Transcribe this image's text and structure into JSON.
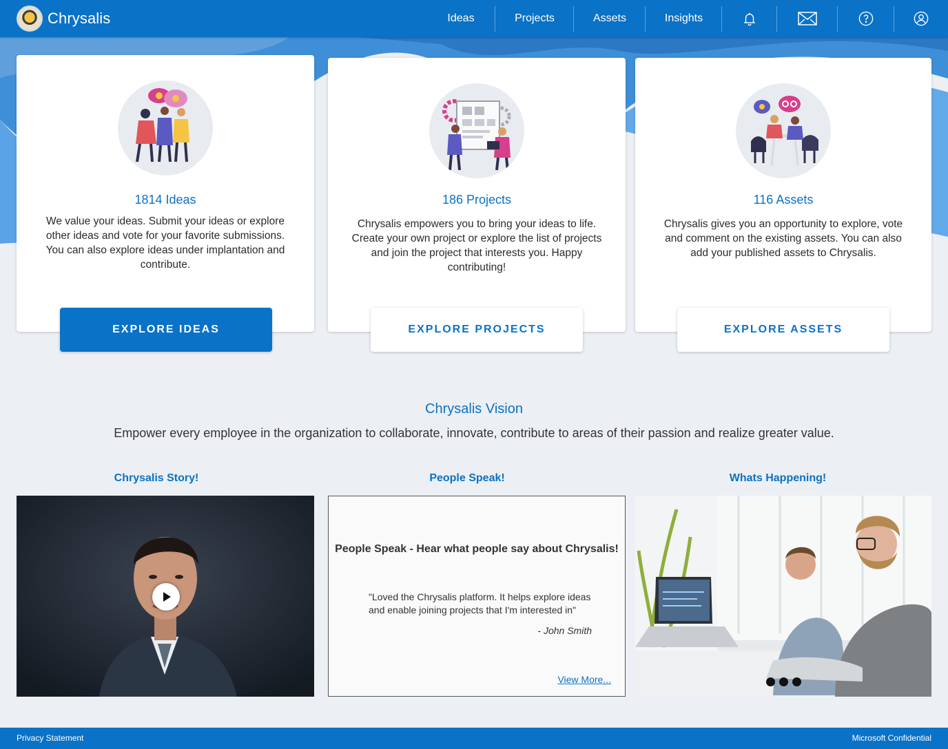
{
  "app": {
    "name": "Chrysalis"
  },
  "nav": {
    "items": [
      {
        "label": "Ideas"
      },
      {
        "label": "Projects"
      },
      {
        "label": "Assets"
      },
      {
        "label": "Insights"
      }
    ],
    "icons": [
      "bell-icon",
      "mail-icon",
      "help-icon",
      "user-icon"
    ]
  },
  "cards": [
    {
      "count": "1814 Ideas",
      "description": "We value your ideas. Submit your ideas or explore other ideas and vote for your favorite submissions. You can also explore ideas under implantation and contribute.",
      "button": "EXPLORE IDEAS"
    },
    {
      "count": "186 Projects",
      "description": "Chrysalis empowers you to bring your ideas to life. Create your own project or explore the list of projects and join the project that interests you. Happy contributing!",
      "button": "EXPLORE PROJECTS"
    },
    {
      "count": "116 Assets",
      "description": "Chrysalis gives you an opportunity to explore, vote and comment on the existing assets. You can also add your published assets to Chrysalis.",
      "button": "EXPLORE ASSETS"
    }
  ],
  "vision": {
    "title": "Chrysalis Vision",
    "text": "Empower every employee in the organization to collaborate, innovate, contribute to areas of their passion and realize greater value."
  },
  "sections": {
    "story_title": "Chrysalis Story!",
    "speak_title": "People Speak!",
    "happening_title": "Whats Happening!"
  },
  "people_speak": {
    "heading": "People Speak - Hear what people say about Chrysalis!",
    "quote": "\"Loved the Chrysalis platform. It helps explore ideas and enable joining projects that I'm interested in\"",
    "author": "- John Smith",
    "view_more": "View  More..."
  },
  "carousel": {
    "slides": 3,
    "active": 1
  },
  "footer": {
    "privacy": "Privacy Statement",
    "confidential": "Microsoft Confidential"
  },
  "colors": {
    "brand": "#0a72c7",
    "background": "#eceff3"
  }
}
